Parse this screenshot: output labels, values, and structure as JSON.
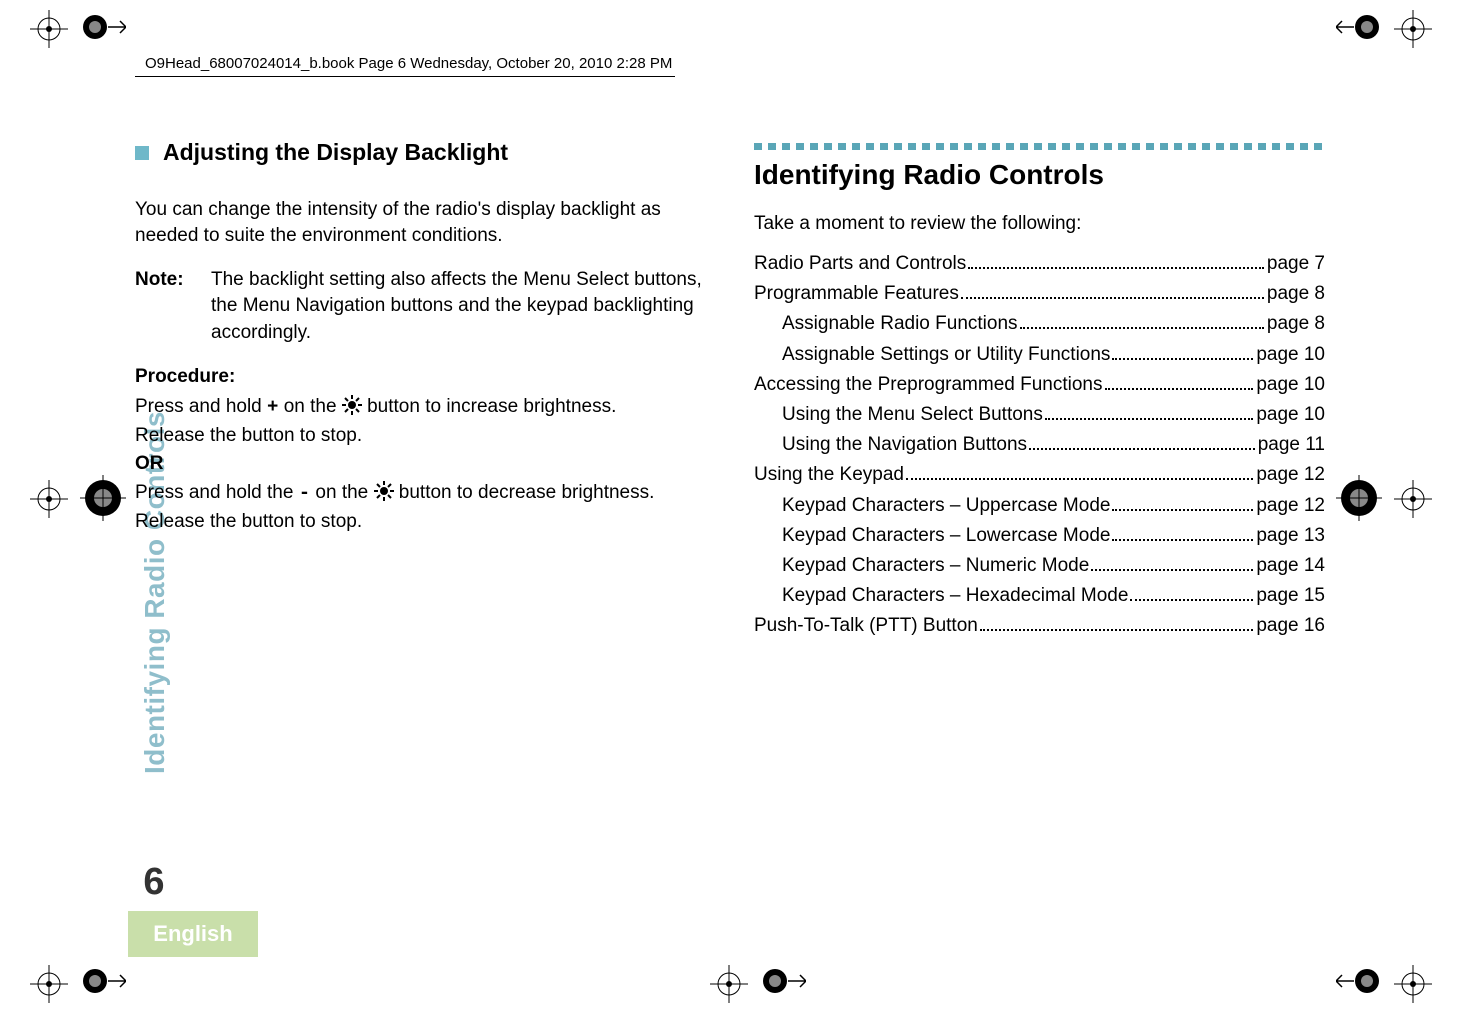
{
  "running_head": "O9Head_68007024014_b.book  Page 6  Wednesday, October 20, 2010  2:28 PM",
  "left": {
    "section_title": "Adjusting the Display Backlight",
    "intro": "You can change the intensity of the radio's display backlight as needed to suite the environment conditions.",
    "note_label": "Note:",
    "note_body": "The backlight setting also affects the Menu Select buttons, the Menu Navigation buttons and the keypad backlighting accordingly.",
    "procedure_label": "Procedure:",
    "line1_a": "Press and hold ",
    "plus": "+",
    "line1_b": " on the ",
    "line1_c": " button to increase brightness.",
    "line2": "Release the button to stop.",
    "or": "OR",
    "line3_a": "Press and hold the ",
    "minus": "-",
    "line3_b": " on the ",
    "line3_c": " button to decrease brightness.",
    "line4": "Release the button to stop."
  },
  "right": {
    "title": "Identifying Radio Controls",
    "intro": "Take a moment to review the following:",
    "toc": [
      {
        "label": "Radio Parts and Controls",
        "page": "page 7",
        "indent": false
      },
      {
        "label": "Programmable Features",
        "page": "page 8",
        "indent": false
      },
      {
        "label": "Assignable Radio Functions",
        "page": "page 8",
        "indent": true
      },
      {
        "label": "Assignable Settings or Utility Functions",
        "page": "page 10",
        "indent": true
      },
      {
        "label": "Accessing the Preprogrammed Functions",
        "page": "page 10",
        "indent": false
      },
      {
        "label": "Using the Menu Select Buttons",
        "page": "page 10",
        "indent": true
      },
      {
        "label": "Using the Navigation Buttons",
        "page": "page 11",
        "indent": true
      },
      {
        "label": "Using the Keypad",
        "page": "page 12",
        "indent": false
      },
      {
        "label": "Keypad Characters – Uppercase Mode",
        "page": "page 12",
        "indent": true
      },
      {
        "label": "Keypad Characters – Lowercase Mode",
        "page": "page 13",
        "indent": true
      },
      {
        "label": "Keypad Characters – Numeric Mode",
        "page": "page 14",
        "indent": true
      },
      {
        "label": "Keypad Characters – Hexadecimal Mode",
        "page": "page 15",
        "indent": true
      },
      {
        "label": "Push-To-Talk (PTT) Button",
        "page": "page 16",
        "indent": false
      }
    ]
  },
  "side": {
    "tab_text": "Identifying Radio Controls",
    "page_number": "6",
    "language": "English"
  }
}
